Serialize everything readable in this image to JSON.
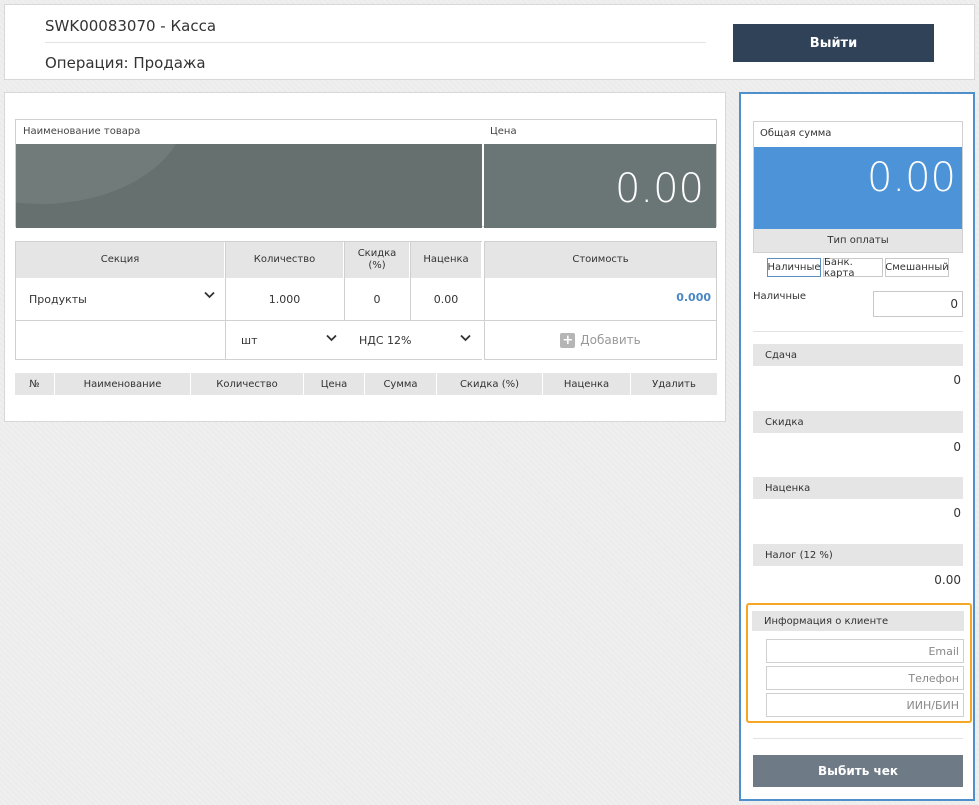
{
  "header": {
    "title": "SWK00083070 - Касса",
    "operation": "Операция: Продажа",
    "exit_label": "Выйти"
  },
  "product": {
    "name_label": "Наименование товара",
    "price_label": "Цена",
    "price_value": "0.00"
  },
  "section_table": {
    "headers": {
      "section": "Секция",
      "quantity": "Количество",
      "discount": "Скидка (%)",
      "markup": "Наценка",
      "cost": "Стоимость"
    },
    "section_value": "Продукты",
    "quantity_value": "1.000",
    "discount_value": "0",
    "markup_value": "0.00",
    "cost_value": "0.000",
    "unit_value": "шт",
    "vat_value": "НДС 12%",
    "add_label": "Добавить"
  },
  "items_table": {
    "columns": [
      "№",
      "Наименование",
      "Количество",
      "Цена",
      "Сумма",
      "Скидка (%)",
      "Наценка",
      "Удалить"
    ]
  },
  "summary": {
    "total_label": "Общая сумма",
    "total_value": "0.00",
    "pay_type_label": "Тип оплаты",
    "pay_types": [
      "Наличные",
      "Банк. карта",
      "Смешанный"
    ],
    "cash_label": "Наличные",
    "cash_value": "0",
    "change_label": "Сдача",
    "change_value": "0",
    "discount_label": "Скидка",
    "discount_value": "0",
    "markup_label": "Наценка",
    "markup_value": "0",
    "tax_label": "Налог (12 %)",
    "tax_value": "0.00"
  },
  "client": {
    "title": "Информация о клиенте",
    "email_placeholder": "Email",
    "phone_placeholder": "Телефон",
    "iin_placeholder": "ИИН/БИН"
  },
  "print_label": "Выбить чек",
  "colors": {
    "header_button": "#2f4257",
    "total_bg": "#4c93d8",
    "panel_border": "#4f8fcb",
    "client_border": "#f5a623",
    "cost_value": "#4a86c5"
  }
}
